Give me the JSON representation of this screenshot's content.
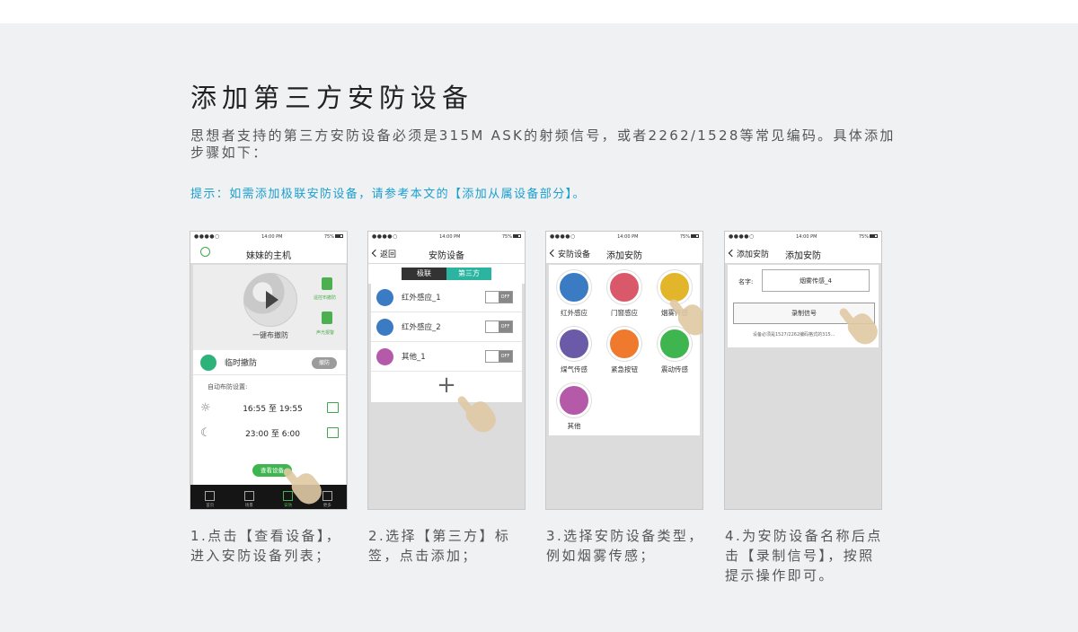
{
  "title": "添加第三方安防设备",
  "description": "思想者支持的第三方安防设备必须是315M ASK的射频信号，或者2262/1528等常见编码。具体添加步骤如下：",
  "tip": "提示：如需添加极联安防设备，请参考本文的【添加从属设备部分】。",
  "status": {
    "dots": "●●●●○",
    "time": "14:00 PM",
    "battery": "75%"
  },
  "phone1": {
    "title": "妹妹的主机",
    "onekey": "一键布撤防",
    "side1": "遥控布撤防",
    "side2": "声光报警",
    "temp_label": "临时撤防",
    "temp_btn": "撤防",
    "auto_label": "自动布防设置:",
    "schedules": [
      {
        "time": "16:55 至 19:55"
      },
      {
        "time": "23:00 至 6:00"
      }
    ],
    "view_btn": "查看设备",
    "tabs": [
      "首页",
      "场景",
      "安防",
      "更多"
    ]
  },
  "phone2": {
    "back": "返回",
    "title": "安防设备",
    "seg_a": "极联",
    "seg_b": "第三方",
    "items": [
      "红外感应_1",
      "红外感应_2",
      "其他_1"
    ],
    "switch": "OFF",
    "plus": "+"
  },
  "phone3": {
    "back": "安防设备",
    "title": "添加安防",
    "cats": [
      {
        "label": "红外感应",
        "color": "#3a7bc4"
      },
      {
        "label": "门窗感应",
        "color": "#d9596b"
      },
      {
        "label": "烟雾传感",
        "color": "#e2b52b"
      },
      {
        "label": "煤气传感",
        "color": "#6a5aa8"
      },
      {
        "label": "紧急按钮",
        "color": "#ef7a2d"
      },
      {
        "label": "震动传感",
        "color": "#3fb54f"
      },
      {
        "label": "其他",
        "color": "#b45aa8"
      }
    ]
  },
  "phone4": {
    "back": "添加安防",
    "title": "添加安防",
    "name_label": "名字:",
    "name_value": "烟雾传感_4",
    "record_btn": "录制信号",
    "hint": "设备必须是1527/2262编码格式的315..."
  },
  "captions": [
    "1.点击【查看设备】，进入安防设备列表；",
    "2.选择【第三方】标签，点击添加；",
    "3.选择安防设备类型，例如烟雾传感；",
    "4.为安防设备名称后点击【录制信号】，按照提示操作即可。"
  ]
}
